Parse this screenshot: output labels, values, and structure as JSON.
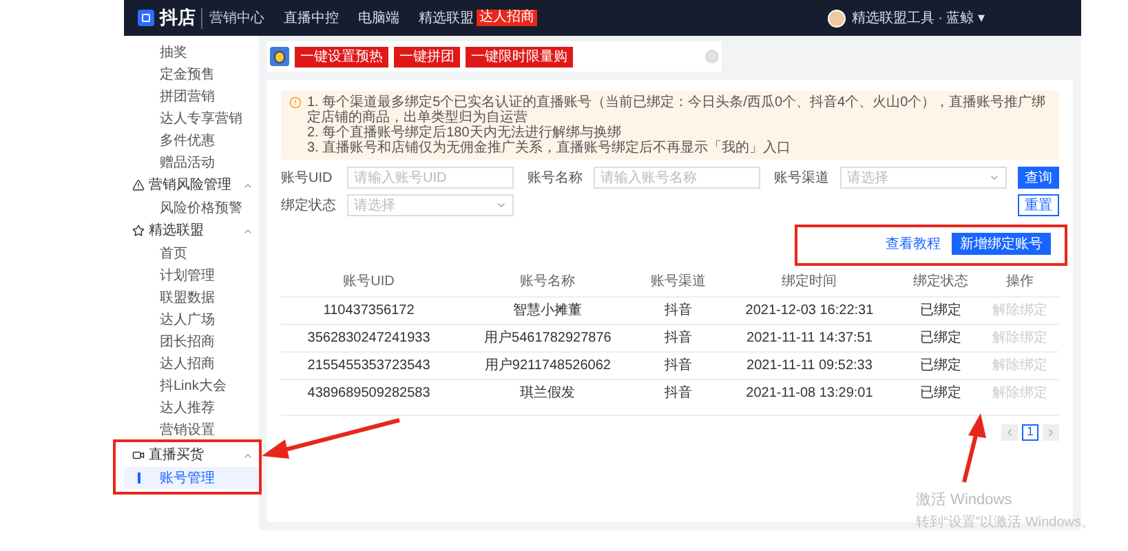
{
  "header": {
    "logo": "抖店",
    "subtitle": "营销中心",
    "nav": [
      {
        "label": "直播中控"
      },
      {
        "label": "电脑端"
      },
      {
        "label": "精选联盟",
        "badge": "达人招商"
      }
    ],
    "user": "精选联盟工具 · 蓝鲸 ▾"
  },
  "sidebar": [
    {
      "label": "抽奖",
      "selected": false
    },
    {
      "label": "定金预售",
      "selected": false
    },
    {
      "label": "拼团营销",
      "selected": false
    },
    {
      "label": "达人专享营销",
      "selected": false
    },
    {
      "label": "多件优惠",
      "selected": false
    },
    {
      "label": "赠品活动",
      "selected": false
    },
    {
      "label": "营销风险管理",
      "kind": "group",
      "expanded": true,
      "children": [
        {
          "label": "风险价格预警",
          "selected": false
        }
      ]
    },
    {
      "label": "精选联盟",
      "kind": "group",
      "expanded": true,
      "children": [
        {
          "label": "首页",
          "selected": false
        },
        {
          "label": "计划管理",
          "selected": false
        },
        {
          "label": "联盟数据",
          "selected": false
        },
        {
          "label": "达人广场",
          "selected": false
        },
        {
          "label": "团长招商",
          "selected": false
        },
        {
          "label": "达人招商",
          "selected": false
        },
        {
          "label": "抖Link大会",
          "selected": false
        },
        {
          "label": "达人推荐",
          "selected": false
        },
        {
          "label": "营销设置",
          "selected": false
        }
      ]
    },
    {
      "label": "直播买货",
      "kind": "group",
      "expanded": true,
      "children": [
        {
          "label": "账号管理",
          "selected": true
        }
      ]
    }
  ],
  "promo_buttons": [
    "一键设置预热",
    "一键拼团",
    "一键限时限量购"
  ],
  "notice": [
    "1. 每个渠道最多绑定5个已实名认证的直播账号（当前已绑定：今日头条/西瓜0个、抖音4个、火山0个），直播账号推广绑定店铺的商品，出单类型归为自运营",
    "2. 每个直播账号绑定后180天内无法进行解绑与换绑",
    "3. 直播账号和店铺仅为无佣金推广关系，直播账号绑定后不再显示「我的」入口"
  ],
  "filters": [
    {
      "label": "账号UID",
      "placeholder": "请输入账号UID",
      "kind": "input"
    },
    {
      "label": "账号名称",
      "placeholder": "请输入账号名称",
      "kind": "input"
    },
    {
      "label": "账号渠道",
      "placeholder": "请选择",
      "kind": "select"
    },
    {
      "label": "绑定状态",
      "placeholder": "请选择",
      "kind": "select"
    }
  ],
  "search_button": "查询",
  "reset_button": "重置",
  "tutorial_link": "查看教程",
  "add_button": "新增绑定账号",
  "table": {
    "columns": [
      "账号UID",
      "账号名称",
      "账号渠道",
      "绑定时间",
      "绑定状态",
      "操作"
    ],
    "rows": [
      [
        "110437356172",
        "智慧小摊董",
        "抖音",
        "2021-12-03 16:22:31",
        "已绑定",
        "解除绑定"
      ],
      [
        "3562830247241933",
        "用户5461782927876",
        "抖音",
        "2021-11-11 14:37:51",
        "已绑定",
        "解除绑定"
      ],
      [
        "2155455353723543",
        "用户9211748526062",
        "抖音",
        "2021-11-11 09:52:33",
        "已绑定",
        "解除绑定"
      ],
      [
        "4389689509282583",
        "琪兰假发",
        "抖音",
        "2021-11-08 13:29:01",
        "已绑定",
        "解除绑定"
      ]
    ]
  },
  "pagination": {
    "pages": [
      {
        "label": "1",
        "selected": true
      }
    ]
  },
  "os_notice": {
    "title": "激活 Windows",
    "text": "转到“设置”以激活 Windows。"
  }
}
